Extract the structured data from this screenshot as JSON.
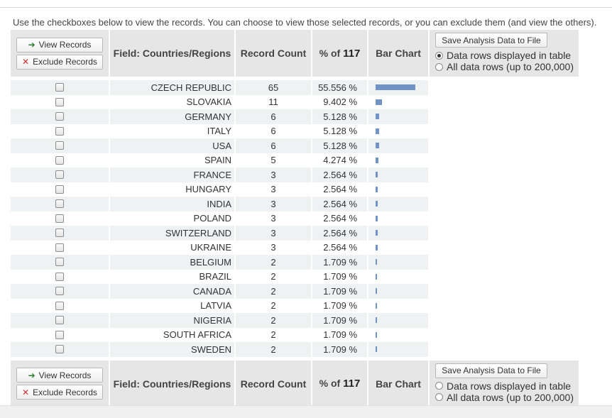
{
  "intro_text": "Use the checkboxes below to view the records. You can choose to view those selected records, or you can exclude them (and view the others).",
  "buttons": {
    "view_records": "View Records",
    "exclude_records": "Exclude Records",
    "save_analysis": "Save Analysis Data to File"
  },
  "headers": {
    "field": "Field: Countries/Regions",
    "record_count": "Record Count",
    "pct_prefix": "% of ",
    "pct_total": "117",
    "bar_chart": "Bar Chart"
  },
  "options": {
    "displayed_rows": "Data rows displayed in table",
    "all_rows": "All data rows (up to 200,000)",
    "top_selected": "displayed_rows",
    "bottom_selected": "none"
  },
  "colors": {
    "bar": "#6f93c7",
    "header_bg": "#e6e6e6",
    "row_alt_bg": "#eef2f3"
  },
  "rows": [
    {
      "name": "CZECH REPUBLIC",
      "count": "65",
      "pct": "55.556 %",
      "fraction": 0.55556
    },
    {
      "name": "SLOVAKIA",
      "count": "11",
      "pct": "9.402 %",
      "fraction": 0.09402
    },
    {
      "name": "GERMANY",
      "count": "6",
      "pct": "5.128 %",
      "fraction": 0.05128
    },
    {
      "name": "ITALY",
      "count": "6",
      "pct": "5.128 %",
      "fraction": 0.05128
    },
    {
      "name": "USA",
      "count": "6",
      "pct": "5.128 %",
      "fraction": 0.05128
    },
    {
      "name": "SPAIN",
      "count": "5",
      "pct": "4.274 %",
      "fraction": 0.04274
    },
    {
      "name": "FRANCE",
      "count": "3",
      "pct": "2.564 %",
      "fraction": 0.02564
    },
    {
      "name": "HUNGARY",
      "count": "3",
      "pct": "2.564 %",
      "fraction": 0.02564
    },
    {
      "name": "INDIA",
      "count": "3",
      "pct": "2.564 %",
      "fraction": 0.02564
    },
    {
      "name": "POLAND",
      "count": "3",
      "pct": "2.564 %",
      "fraction": 0.02564
    },
    {
      "name": "SWITZERLAND",
      "count": "3",
      "pct": "2.564 %",
      "fraction": 0.02564
    },
    {
      "name": "UKRAINE",
      "count": "3",
      "pct": "2.564 %",
      "fraction": 0.02564
    },
    {
      "name": "BELGIUM",
      "count": "2",
      "pct": "1.709 %",
      "fraction": 0.01709
    },
    {
      "name": "BRAZIL",
      "count": "2",
      "pct": "1.709 %",
      "fraction": 0.01709
    },
    {
      "name": "CANADA",
      "count": "2",
      "pct": "1.709 %",
      "fraction": 0.01709
    },
    {
      "name": "LATVIA",
      "count": "2",
      "pct": "1.709 %",
      "fraction": 0.01709
    },
    {
      "name": "NIGERIA",
      "count": "2",
      "pct": "1.709 %",
      "fraction": 0.01709
    },
    {
      "name": "SOUTH AFRICA",
      "count": "2",
      "pct": "1.709 %",
      "fraction": 0.01709
    },
    {
      "name": "SWEDEN",
      "count": "2",
      "pct": "1.709 %",
      "fraction": 0.01709
    }
  ]
}
